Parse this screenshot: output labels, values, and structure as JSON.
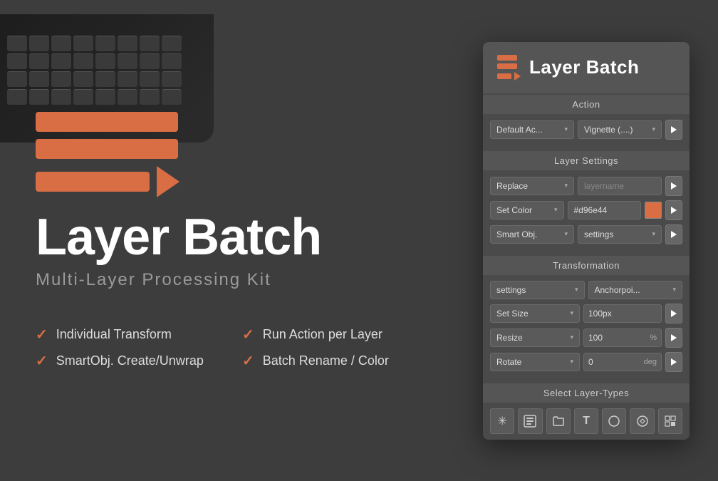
{
  "app": {
    "title": "Layer Batch",
    "subtitle": "Multi-Layer Processing Kit",
    "logo_alt": "Layer Batch Logo"
  },
  "features": [
    {
      "id": "individual-transform",
      "text": "Individual Transform"
    },
    {
      "id": "run-action-per-layer",
      "text": "Run Action per Layer"
    },
    {
      "id": "smartobj-create-unwrap",
      "text": "SmartObj. Create/Unwrap"
    },
    {
      "id": "batch-rename-color",
      "text": "Batch Rename / Color"
    }
  ],
  "panel": {
    "title": "Layer Batch",
    "sections": {
      "action": {
        "label": "Action",
        "dropdown1": {
          "value": "Default Ac...",
          "options": [
            "Default Ac..."
          ]
        },
        "dropdown2": {
          "value": "Vignette (....)",
          "options": [
            "Vignette (..."
          ]
        },
        "run_button": "▶"
      },
      "layer_settings": {
        "label": "Layer Settings",
        "row1": {
          "select": {
            "value": "Replace",
            "options": [
              "Replace"
            ]
          },
          "input": {
            "placeholder": "layername",
            "value": ""
          },
          "button": "▶"
        },
        "row2": {
          "select": {
            "value": "Set Color",
            "options": [
              "Set Color"
            ]
          },
          "color_hex": "#d96e44",
          "color_swatch": "#d96e44",
          "button": "▶"
        },
        "row3": {
          "select": {
            "value": "Smart Obj.",
            "options": [
              "Smart Obj."
            ]
          },
          "select2": {
            "value": "settings",
            "options": [
              "settings"
            ]
          },
          "button": "▶"
        }
      },
      "transformation": {
        "label": "Transformation",
        "row1": {
          "select1": {
            "value": "settings",
            "options": [
              "settings"
            ]
          },
          "select2": {
            "value": "Anchorpoi...",
            "options": [
              "Anchorpoi..."
            ]
          }
        },
        "row2": {
          "select": {
            "value": "Set Size",
            "options": [
              "Set Size"
            ]
          },
          "value": "100px",
          "button": "▶"
        },
        "row3": {
          "select": {
            "value": "Resize",
            "options": [
              "Resize"
            ]
          },
          "value": "100",
          "unit": "%",
          "button": "▶"
        },
        "row4": {
          "select": {
            "value": "Rotate",
            "options": [
              "Rotate"
            ]
          },
          "value": "0",
          "unit": "deg",
          "button": "▶"
        }
      },
      "select_layer_types": {
        "label": "Select Layer-Types",
        "buttons": [
          {
            "id": "all-layers",
            "icon": "✳",
            "title": "All Layers"
          },
          {
            "id": "group-layer",
            "icon": "▣",
            "title": "Group Layer"
          },
          {
            "id": "folder-layer",
            "icon": "🗀",
            "title": "Folder"
          },
          {
            "id": "text-layer",
            "icon": "T",
            "title": "Text Layer"
          },
          {
            "id": "shape-layer",
            "icon": "●",
            "title": "Shape Layer"
          },
          {
            "id": "smart-object",
            "icon": "◎",
            "title": "Smart Object"
          },
          {
            "id": "pixel-layer",
            "icon": "▩",
            "title": "Pixel Layer"
          }
        ]
      }
    }
  }
}
